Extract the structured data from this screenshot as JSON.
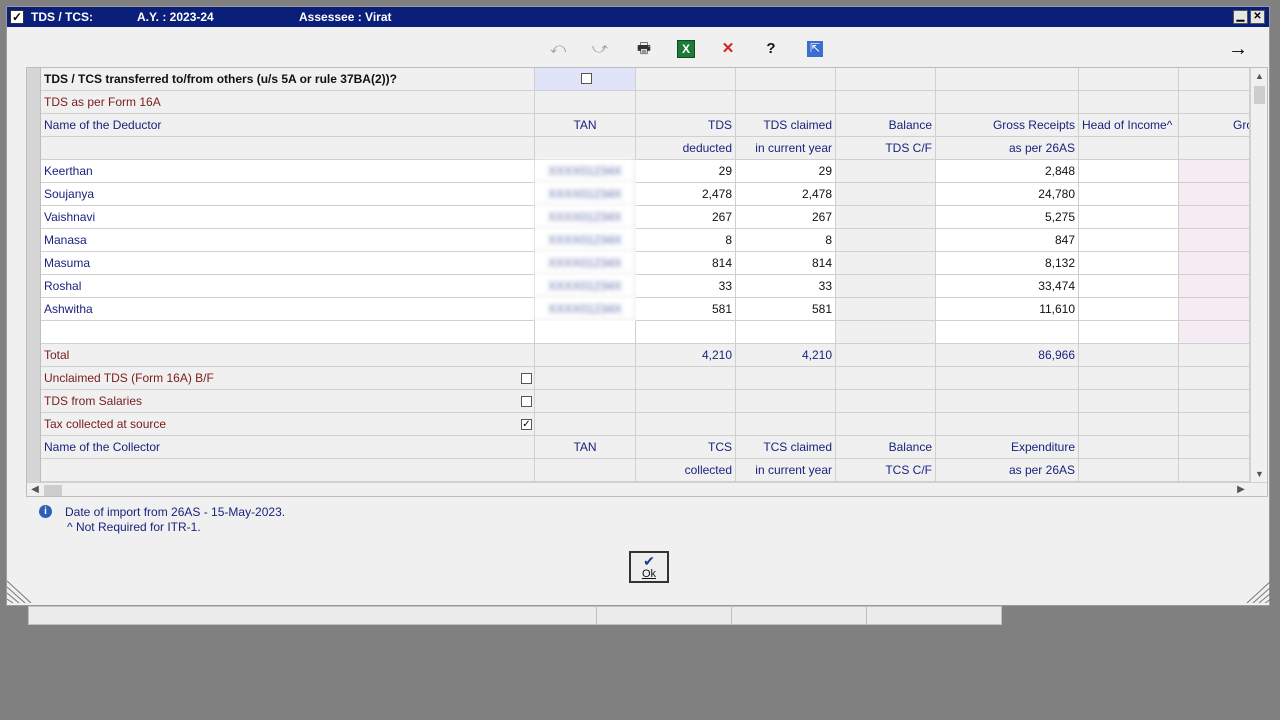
{
  "title": {
    "name": "TDS / TCS:",
    "ay": "A.Y. : 2023-24",
    "assessee": "Assessee : Virat"
  },
  "toolbar": {
    "undo": "⤺",
    "redo": "⤻",
    "print": "🖶",
    "excel": "X",
    "delete": "✕",
    "help": "?",
    "export": "⇱",
    "next": "→"
  },
  "grid": {
    "transfer_question": "TDS / TCS transferred to/from others (u/s 5A or rule 37BA(2))?",
    "tds_16a_label": "TDS as per Form 16A",
    "deductor_headers": {
      "name": "Name of the Deductor",
      "tan": "TAN",
      "tds": "TDS",
      "tds_sub": "deducted",
      "claimed": "TDS claimed",
      "claimed_sub": "in current year",
      "balance": "Balance",
      "balance_sub": "TDS C/F",
      "gross": "Gross Receipts",
      "gross_sub": "as per 26AS",
      "head": "Head of Income^",
      "gross2": "Gros"
    },
    "deductors": [
      {
        "name": "Keerthan",
        "tan": "XXXX01234X",
        "tds": "29",
        "claimed": "29",
        "balance": "",
        "gross": "2,848"
      },
      {
        "name": "Soujanya",
        "tan": "XXXX01234X",
        "tds": "2,478",
        "claimed": "2,478",
        "balance": "",
        "gross": "24,780"
      },
      {
        "name": "Vaishnavi",
        "tan": "XXXX01234X",
        "tds": "267",
        "claimed": "267",
        "balance": "",
        "gross": "5,275"
      },
      {
        "name": "Manasa",
        "tan": "XXXX01234X",
        "tds": "8",
        "claimed": "8",
        "balance": "",
        "gross": "847"
      },
      {
        "name": "Masuma",
        "tan": "XXXX01234X",
        "tds": "814",
        "claimed": "814",
        "balance": "",
        "gross": "8,132"
      },
      {
        "name": "Roshal",
        "tan": "XXXX01234X",
        "tds": "33",
        "claimed": "33",
        "balance": "",
        "gross": "33,474"
      },
      {
        "name": "Ashwitha",
        "tan": "XXXX01234X",
        "tds": "581",
        "claimed": "581",
        "balance": "",
        "gross": "11,610"
      }
    ],
    "total": {
      "label": "Total",
      "tds": "4,210",
      "claimed": "4,210",
      "gross": "86,966"
    },
    "unclaimed_label": "Unclaimed TDS (Form 16A) B/F",
    "unclaimed_checked": false,
    "salaries_label": "TDS from Salaries",
    "salaries_checked": false,
    "tcs_label": "Tax collected at source",
    "tcs_checked": true,
    "collector_headers": {
      "name": "Name of the Collector",
      "tan": "TAN",
      "tcs": "TCS",
      "tcs_sub": "collected",
      "claimed": "TCS claimed",
      "claimed_sub": "in current year",
      "balance": "Balance",
      "balance_sub": "TCS C/F",
      "expenditure": "Expenditure",
      "expenditure_sub": "as per 26AS"
    }
  },
  "notes": {
    "import_date": "Date of import from 26AS - 15-May-2023.",
    "not_required": "^ Not Required for ITR-1."
  },
  "ok_label": "Ok"
}
